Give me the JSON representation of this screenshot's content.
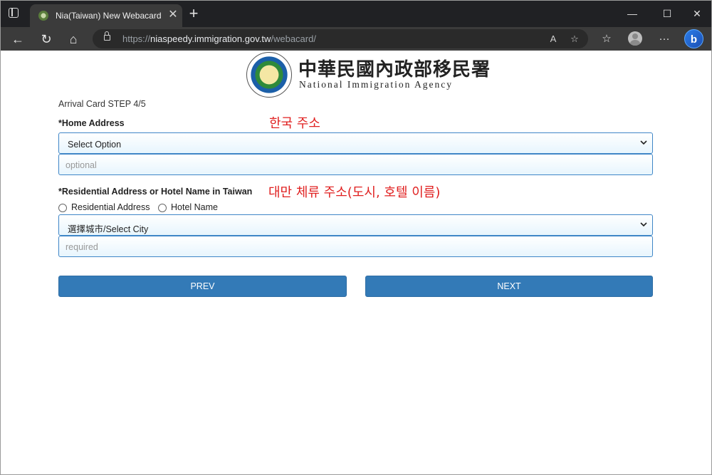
{
  "browser": {
    "tab_title": "Nia(Taiwan) New Webacard",
    "url_scheme": "https://",
    "url_host": "niaspeedy.immigration.gov.tw",
    "url_path": "/webacard/"
  },
  "agency": {
    "name_cn": "中華民國內政部移民署",
    "name_en": "National Immigration Agency"
  },
  "form": {
    "step_title": "Arrival Card STEP 4/5",
    "home_address": {
      "label": "*Home Address",
      "annotation": "한국 주소",
      "select_value": "Select Option",
      "input_placeholder": "optional"
    },
    "residential": {
      "label": "*Residential Address or Hotel Name in Taiwan",
      "annotation": "대만 체류 주소(도시, 호텔 이름)",
      "radio_options": [
        "Residential Address",
        "Hotel Name"
      ],
      "select_value": "選擇城市/Select City",
      "input_placeholder": "required"
    },
    "prev_label": "PREV",
    "next_label": "NEXT"
  },
  "colors": {
    "accent": "#337ab7",
    "annotation": "#e02020",
    "field_border": "#3f86c7"
  }
}
